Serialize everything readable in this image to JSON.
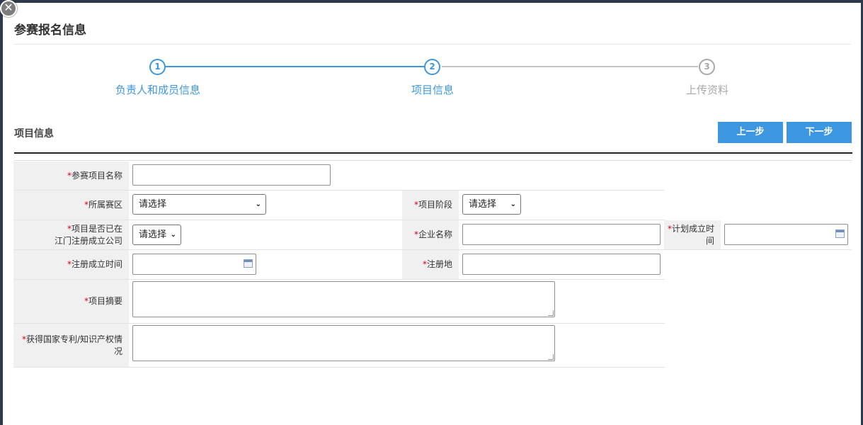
{
  "dialog": {
    "title": "参赛报名信息"
  },
  "steps": [
    {
      "num": "1",
      "label": "负责人和成员信息"
    },
    {
      "num": "2",
      "label": "项目信息"
    },
    {
      "num": "3",
      "label": "上传资料"
    }
  ],
  "section": {
    "title": "项目信息",
    "prev_label": "上一步",
    "next_label": "下一步"
  },
  "form": {
    "required_mark": "*",
    "project_name_label": "参赛项目名称",
    "region_label": "所属赛区",
    "region_value": "请选择",
    "stage_label": "项目阶段",
    "stage_value": "请选择",
    "registered_label_1": "项目是否已在",
    "registered_label_2": "江门注册成立公司",
    "registered_value": "请选择",
    "company_label": "企业名称",
    "planned_time_label_1": "计划成立时",
    "planned_time_label_2": "间",
    "reg_time_label": "注册成立时间",
    "reg_place_label": "注册地",
    "summary_label": "项目摘要",
    "patent_label_1": "获得国家专利/知识产权情",
    "patent_label_2": "况"
  }
}
